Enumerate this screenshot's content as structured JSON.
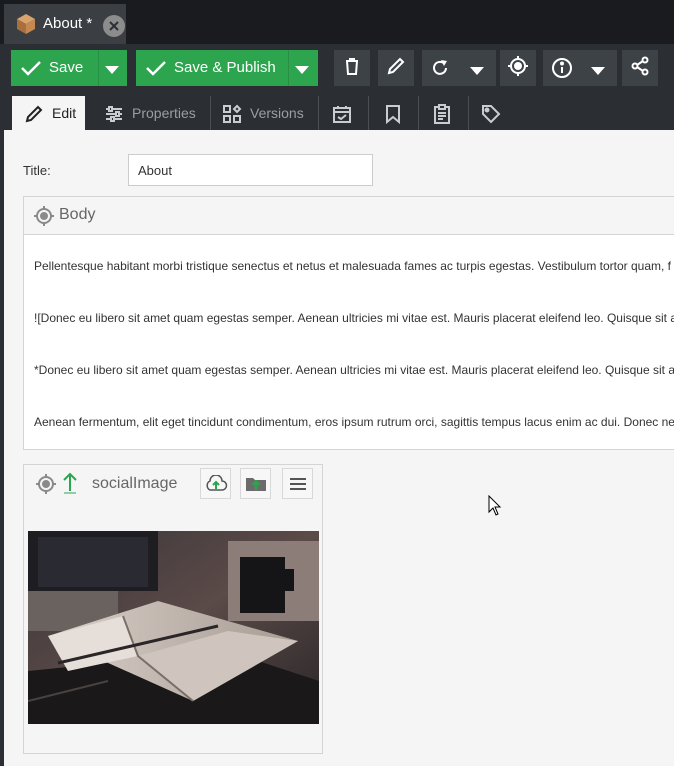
{
  "document_tab": {
    "title": "About *"
  },
  "toolbar": {
    "save_label": "Save",
    "save_publish_label": "Save & Publish",
    "icons": [
      "delete-icon",
      "edit-icon",
      "reload-icon",
      "target-icon",
      "info-icon",
      "share-icon"
    ]
  },
  "view_tabs": [
    {
      "label": "Edit",
      "icon": "pencil-icon"
    },
    {
      "label": "Properties",
      "icon": "sliders-icon"
    },
    {
      "label": "Versions",
      "icon": "versions-icon"
    },
    {
      "label": "",
      "icon": "calendar-check-icon"
    },
    {
      "label": "",
      "icon": "bookmark-icon"
    },
    {
      "label": "",
      "icon": "clipboard-icon"
    },
    {
      "label": "",
      "icon": "tag-icon"
    }
  ],
  "form": {
    "title_label": "Title:",
    "title_value": "About"
  },
  "body_panel": {
    "heading": "Body",
    "paragraphs": [
      "Pellentesque habitant morbi tristique senectus et netus et malesuada fames ac turpis egestas. Vestibulum tortor quam, f",
      "![Donec eu libero sit amet quam egestas semper. Aenean ultricies mi vitae est. Mauris placerat eleifend leo. Quisque sit a",
      "*Donec eu libero sit amet quam egestas semper. Aenean ultricies mi vitae est. Mauris placerat eleifend leo. Quisque sit a",
      "Aenean fermentum, elit eget tincidunt condimentum, eros ipsum rutrum orci, sagittis tempus lacus enim ac dui. Donec ne"
    ]
  },
  "image_panel": {
    "heading": "socialImage"
  },
  "colors": {
    "green": "#2da44e",
    "toolbar_bg": "#2b2f34",
    "tabbar_bg": "#191b1e"
  }
}
